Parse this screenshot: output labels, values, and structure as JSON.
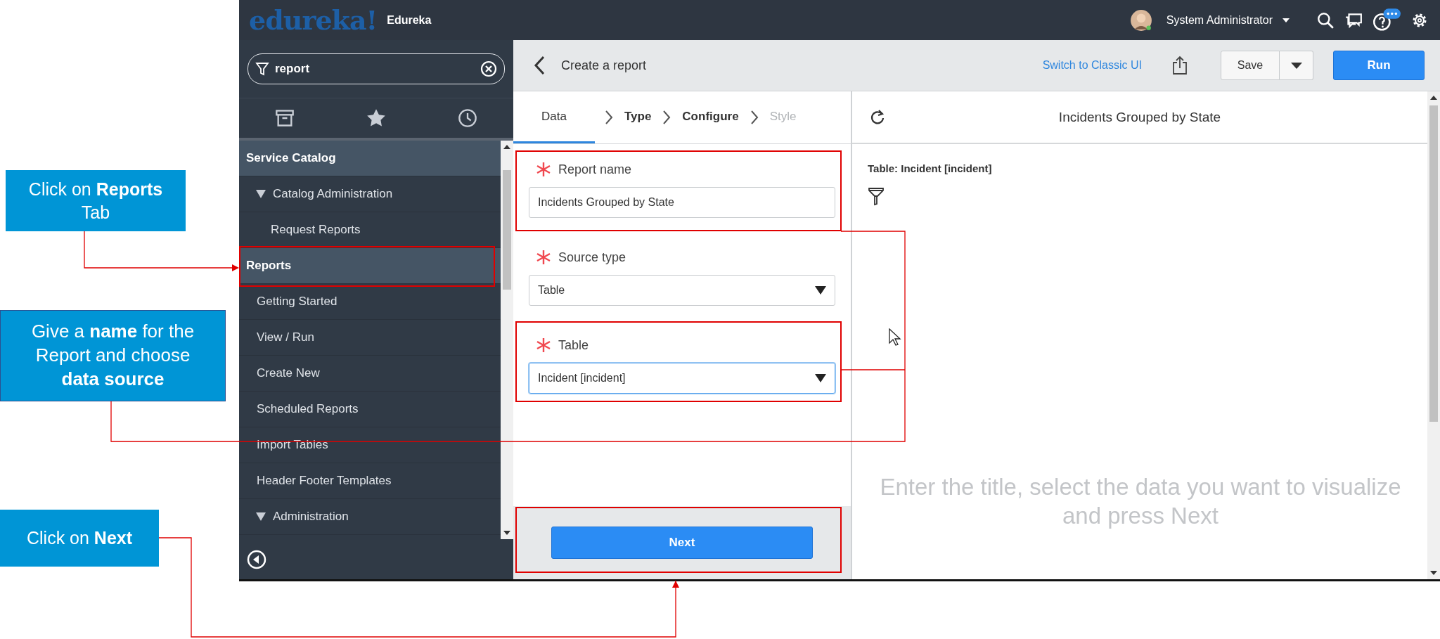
{
  "annotations": {
    "callouts": [
      {
        "text": "Click on **Reports** Tab"
      },
      {
        "text": "Give a **name** for the Report and choose **data source**"
      },
      {
        "text": "Click on **Next**"
      }
    ]
  },
  "header": {
    "logo": "edureka!",
    "instance": "Edureka",
    "user": "System Administrator"
  },
  "sidebar": {
    "search": {
      "value": "report"
    },
    "items": [
      {
        "label": "Service Catalog",
        "kind": "section",
        "expanded": false
      },
      {
        "label": "Catalog Administration",
        "kind": "group",
        "expanded": true
      },
      {
        "label": "Request Reports",
        "kind": "sublink",
        "expanded": false
      },
      {
        "label": "Reports",
        "kind": "section",
        "expanded": false
      },
      {
        "label": "Getting Started",
        "kind": "link",
        "expanded": false
      },
      {
        "label": "View / Run",
        "kind": "link",
        "expanded": false
      },
      {
        "label": "Create New",
        "kind": "link",
        "expanded": false
      },
      {
        "label": "Scheduled Reports",
        "kind": "link",
        "expanded": false
      },
      {
        "label": "Import Tables",
        "kind": "link",
        "expanded": false
      },
      {
        "label": "Header Footer Templates",
        "kind": "link",
        "expanded": false
      },
      {
        "label": "Administration",
        "kind": "group",
        "expanded": true
      }
    ]
  },
  "main": {
    "title": "Create a report",
    "switch_link": "Switch to Classic UI",
    "save": "Save",
    "run": "Run",
    "steps": [
      {
        "label": "Data",
        "selected": true,
        "disabled": false
      },
      {
        "label": "Type",
        "selected": false,
        "disabled": false
      },
      {
        "label": "Configure",
        "selected": false,
        "disabled": false
      },
      {
        "label": "Style",
        "selected": false,
        "disabled": true
      }
    ],
    "fields": [
      {
        "label": "Report name",
        "required": true,
        "kind": "text",
        "value": "Incidents Grouped by State",
        "focused": false
      },
      {
        "label": "Source type",
        "required": true,
        "kind": "select",
        "value": "Table",
        "focused": false
      },
      {
        "label": "Table",
        "required": true,
        "kind": "select",
        "value": "Incident [incident]",
        "focused": true
      }
    ],
    "next": "Next",
    "preview": {
      "title": "Incidents Grouped by State",
      "table": "Table: Incident [incident]",
      "hint": "Enter the title, select the data you want to visualize and press Next"
    }
  }
}
